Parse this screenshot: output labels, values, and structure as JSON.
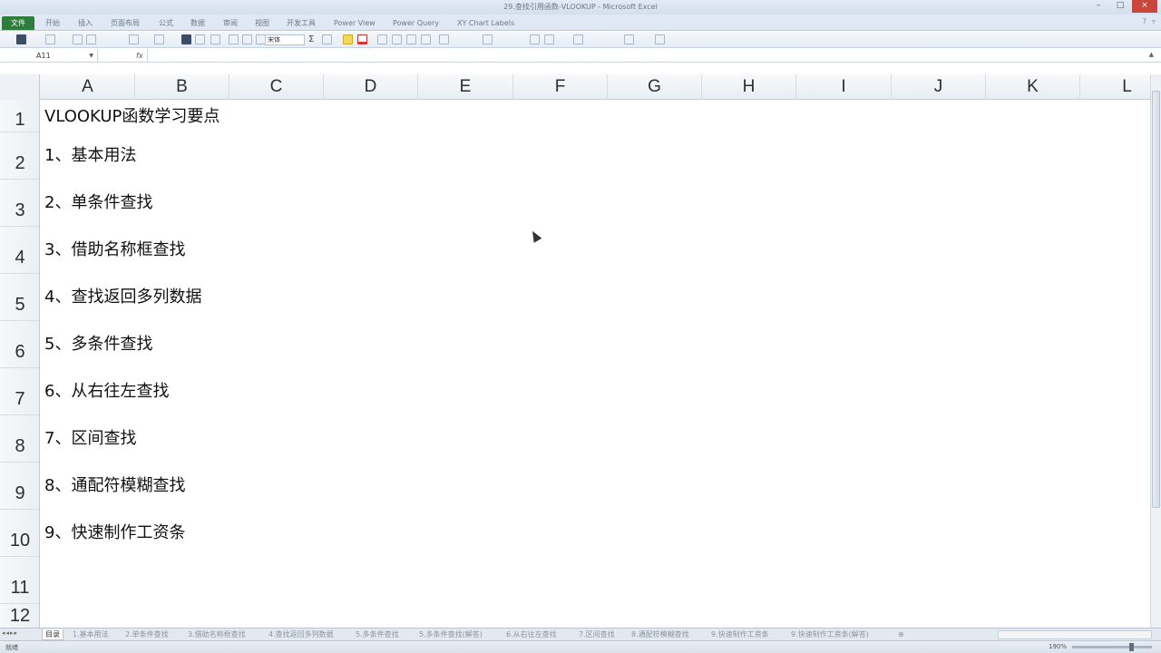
{
  "window": {
    "title": "29.查找引用函数-VLOOKUP - Microsoft Excel",
    "buttons": [
      "–",
      "□",
      "×"
    ]
  },
  "ribbon_tabs": [
    "文件",
    "开始",
    "插入",
    "页面布局",
    "公式",
    "数据",
    "审阅",
    "视图",
    "开发工具",
    "Power View",
    "Power Query",
    "XY Chart Labels"
  ],
  "font_name": "宋体",
  "formula_bar": {
    "name_box": "A11",
    "fx": "fx",
    "formula": ""
  },
  "columns": [
    "A",
    "B",
    "C",
    "D",
    "E",
    "F",
    "G",
    "H",
    "I",
    "J",
    "K",
    "L"
  ],
  "rows": [
    "1",
    "2",
    "3",
    "4",
    "5",
    "6",
    "7",
    "8",
    "9",
    "10",
    "11",
    "12"
  ],
  "cells": [
    "VLOOKUP函数学习要点",
    "1、基本用法",
    "2、单条件查找",
    "3、借助名称框查找",
    "4、查找返回多列数据",
    "5、多条件查找",
    "6、从右往左查找",
    "7、区间查找",
    "8、通配符模糊查找",
    "9、快速制作工资条"
  ],
  "sheet_tabs": [
    "目录",
    "1.基本用法",
    "2.单条件查找",
    "3.借助名称框查找",
    "4.查找返回多列数据",
    "5.多条件查找",
    "5.多条件查找(解答)",
    "6.从右往左查找",
    "7.区间查找",
    "8.通配符模糊查找",
    "9.快速制作工资条",
    "9.快速制作工资条(解答)"
  ],
  "status": {
    "ready": "就绪",
    "zoom": "190%"
  }
}
